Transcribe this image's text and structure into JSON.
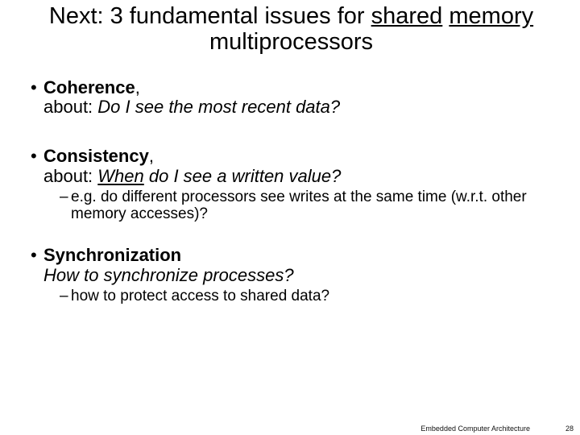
{
  "title": {
    "prefix": "Next: 3 fundamental issues for ",
    "u1": "shared",
    "mid": " ",
    "u2": "memory",
    "suffix": " multiprocessors"
  },
  "b1": {
    "head": "Coherence",
    "comma": ",",
    "line2a": "about: ",
    "line2i": "Do I see the most recent data?"
  },
  "b2": {
    "head": "Consistency",
    "comma": ",",
    "line2a": "about: ",
    "line2u": "When",
    "line2i": " do I see a written value?",
    "sub": "e.g. do different processors see writes at the same time (w.r.t. other memory accesses)?"
  },
  "b3": {
    "head": "Synchronization",
    "line2i": "How to synchronize processes?",
    "sub": "how to protect access to shared data?"
  },
  "footer": {
    "course": "Embedded Computer Architecture",
    "page": "28"
  }
}
